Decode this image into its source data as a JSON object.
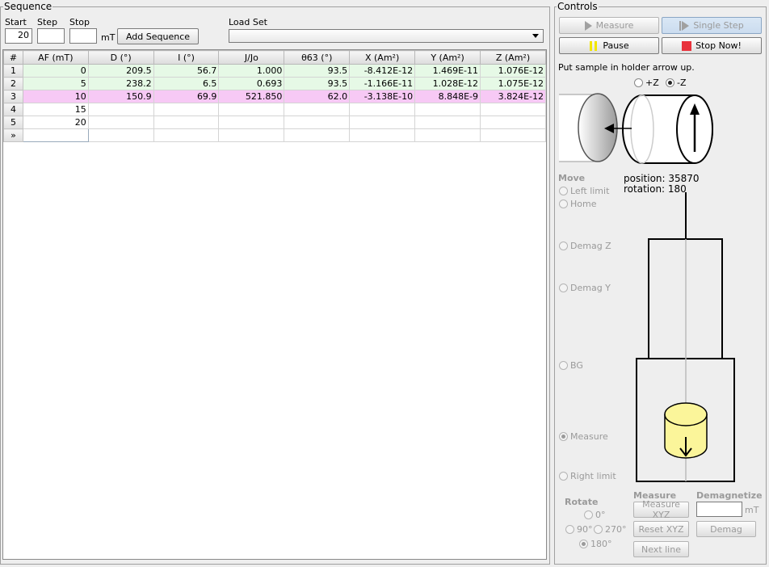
{
  "sequence": {
    "title": "Sequence",
    "start_label": "Start",
    "start_value": "20",
    "step_label": "Step",
    "step_value": "",
    "stop_label": "Stop",
    "stop_value": "",
    "unit": "mT",
    "add_button": "Add Sequence",
    "loadset_label": "Load Set",
    "loadset_value": ""
  },
  "table": {
    "headers": [
      "#",
      "AF (mT)",
      "D (°)",
      "I (°)",
      "J/Jo",
      "θ63 (°)",
      "X (Am²)",
      "Y (Am²)",
      "Z (Am²)"
    ],
    "rows": [
      {
        "num": "1",
        "af": "0",
        "d": "209.5",
        "i": "56.7",
        "jjo": "1.000",
        "t63": "93.5",
        "x": "-8.412E-12",
        "y": "1.469E-11",
        "z": "1.076E-12"
      },
      {
        "num": "2",
        "af": "5",
        "d": "238.2",
        "i": "6.5",
        "jjo": "0.693",
        "t63": "93.5",
        "x": "-1.166E-11",
        "y": "1.028E-12",
        "z": "1.075E-12"
      },
      {
        "num": "3",
        "af": "10",
        "d": "150.9",
        "i": "69.9",
        "jjo": "521.850",
        "t63": "62.0",
        "x": "-3.138E-10",
        "y": "8.848E-9",
        "z": "3.824E-12"
      },
      {
        "num": "4",
        "af": "15",
        "d": "",
        "i": "",
        "jjo": "",
        "t63": "",
        "x": "",
        "y": "",
        "z": ""
      },
      {
        "num": "5",
        "af": "20",
        "d": "",
        "i": "",
        "jjo": "",
        "t63": "",
        "x": "",
        "y": "",
        "z": ""
      }
    ],
    "new_row_marker": "»"
  },
  "controls": {
    "title": "Controls",
    "measure_btn": "Measure",
    "single_step_btn": "Single Step",
    "pause_btn": "Pause",
    "stop_btn": "Stop Now!",
    "instruction": "Put sample in holder arrow up.",
    "plus_z": "+Z",
    "minus_z": "-Z",
    "position_text": "position: 35870",
    "rotation_text": "rotation: 180",
    "move_title": "Move",
    "move_left_limit": "Left limit",
    "move_home": "Home",
    "move_demag_z": "Demag Z",
    "move_demag_y": "Demag Y",
    "move_bg": "BG",
    "move_measure": "Measure",
    "move_right_limit": "Right limit",
    "rotate_title": "Rotate",
    "rot_0": "0°",
    "rot_90": "90°",
    "rot_270": "270°",
    "rot_180": "180°",
    "measure_title": "Measure",
    "measure_xyz": "Measure XYZ",
    "reset_xyz": "Reset XYZ",
    "next_line": "Next line",
    "demag_title": "Demagnetize",
    "demag_value": "",
    "demag_unit": "mT",
    "demag_btn": "Demag"
  },
  "colors": {
    "measured_row": "#e6f9e6",
    "highlight_row": "#f7c9f5",
    "stop_red": "#e8323c",
    "pause_yellow": "#f2e600",
    "sample_yellow": "#fbf59a"
  },
  "icons": [
    "play-icon",
    "step-icon",
    "pause-icon",
    "stop-icon",
    "arrow-up-icon",
    "arrow-down-icon",
    "arrow-left-icon"
  ]
}
